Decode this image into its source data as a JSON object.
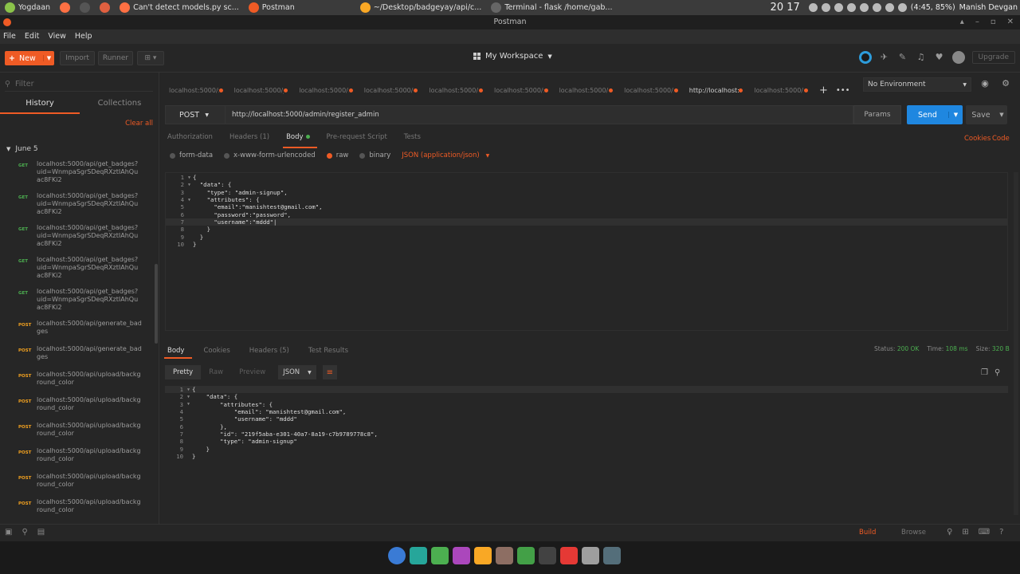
{
  "topbar": {
    "items": [
      {
        "label": "Yogdaan",
        "color": "#8bc34a"
      },
      {
        "label": "",
        "color": "#ff7043"
      },
      {
        "label": "",
        "color": "#555555"
      },
      {
        "label": "",
        "color": "#e06040"
      },
      {
        "label": "Can't detect models.py sc...",
        "color": "#ff7043"
      },
      {
        "label": "Postman",
        "color": "#ef5b25"
      },
      {
        "label": "~/Desktop/badgeyay/api/c...",
        "color": "#f9a825"
      },
      {
        "label": "Terminal - flask  /home/gab...",
        "color": "#666666"
      }
    ],
    "clock": "20 17",
    "battery": "(4:45, 85%)",
    "user": "Manish Devgan"
  },
  "window": {
    "title": "Postman"
  },
  "menu": [
    "File",
    "Edit",
    "View",
    "Help"
  ],
  "toolbar": {
    "new_label": "New",
    "import_label": "Import",
    "runner_label": "Runner",
    "workspace_label": "My Workspace",
    "upgrade_label": "Upgrade"
  },
  "sidebar": {
    "filter_placeholder": "Filter",
    "tabs": [
      "History",
      "Collections"
    ],
    "clear_all": "Clear all",
    "date_group": "June 5",
    "history": [
      {
        "method": "GET",
        "url": "localhost:5000/api/get_badges?uid=WnmpaSgrSDeqRXztIAhQuac8FKi2"
      },
      {
        "method": "GET",
        "url": "localhost:5000/api/get_badges?uid=WnmpaSgrSDeqRXztIAhQuac8FKi2"
      },
      {
        "method": "GET",
        "url": "localhost:5000/api/get_badges?uid=WnmpaSgrSDeqRXztIAhQuac8FKi2"
      },
      {
        "method": "GET",
        "url": "localhost:5000/api/get_badges?uid=WnmpaSgrSDeqRXztIAhQuac8FKi2"
      },
      {
        "method": "GET",
        "url": "localhost:5000/api/get_badges?uid=WnmpaSgrSDeqRXztIAhQuac8FKi2"
      },
      {
        "method": "POST",
        "url": "localhost:5000/api/generate_badges"
      },
      {
        "method": "POST",
        "url": "localhost:5000/api/generate_badges"
      },
      {
        "method": "POST",
        "url": "localhost:5000/api/upload/background_color"
      },
      {
        "method": "POST",
        "url": "localhost:5000/api/upload/background_color"
      },
      {
        "method": "POST",
        "url": "localhost:5000/api/upload/background_color"
      },
      {
        "method": "POST",
        "url": "localhost:5000/api/upload/background_color"
      },
      {
        "method": "POST",
        "url": "localhost:5000/api/upload/background_color"
      },
      {
        "method": "POST",
        "url": "localhost:5000/api/upload/background_color"
      }
    ]
  },
  "request_tabs": [
    {
      "label": "localhost:5000/:",
      "active": false
    },
    {
      "label": "localhost:5000/j",
      "active": false
    },
    {
      "label": "localhost:5000/:",
      "active": false
    },
    {
      "label": "localhost:5000/:",
      "active": false
    },
    {
      "label": "localhost:5000/:",
      "active": false
    },
    {
      "label": "localhost:5000/:",
      "active": false
    },
    {
      "label": "localhost:5000/:",
      "active": false
    },
    {
      "label": "localhost:5000/:",
      "active": false
    },
    {
      "label": "http://localhost:",
      "active": true
    },
    {
      "label": "localhost:5000/:",
      "active": false
    }
  ],
  "environment": {
    "selected": "No Environment"
  },
  "request": {
    "method": "POST",
    "url": "http://localhost:5000/admin/register_admin",
    "params_label": "Params",
    "send_label": "Send",
    "save_label": "Save",
    "tabs": [
      {
        "label": "Authorization",
        "active": false
      },
      {
        "label": "Headers (1)",
        "active": false
      },
      {
        "label": "Body",
        "active": true
      },
      {
        "label": "Pre-request Script",
        "active": false
      },
      {
        "label": "Tests",
        "active": false
      }
    ],
    "cookies_label": "Cookies",
    "code_label": "Code",
    "body_types": [
      {
        "label": "form-data",
        "selected": false
      },
      {
        "label": "x-www-form-urlencoded",
        "selected": false
      },
      {
        "label": "raw",
        "selected": true
      },
      {
        "label": "binary",
        "selected": false
      }
    ],
    "content_type": "JSON (application/json)",
    "body_lines": [
      {
        "n": "1",
        "fold": true,
        "text": "{"
      },
      {
        "n": "2",
        "fold": true,
        "text": "  \"data\": {"
      },
      {
        "n": "3",
        "fold": false,
        "text": "    \"type\": \"admin-signup\","
      },
      {
        "n": "4",
        "fold": true,
        "text": "    \"attributes\": {"
      },
      {
        "n": "5",
        "fold": false,
        "text": "      \"email\":\"manishtest@gmail.com\","
      },
      {
        "n": "6",
        "fold": false,
        "text": "      \"password\":\"password\","
      },
      {
        "n": "7",
        "fold": false,
        "text": "      \"username\":\"mddd\"|"
      },
      {
        "n": "8",
        "fold": false,
        "text": "    }"
      },
      {
        "n": "9",
        "fold": false,
        "text": "  }"
      },
      {
        "n": "10",
        "fold": false,
        "text": "}"
      }
    ]
  },
  "response": {
    "tabs": [
      {
        "label": "Body",
        "active": true
      },
      {
        "label": "Cookies",
        "active": false
      },
      {
        "label": "Headers (5)",
        "active": false
      },
      {
        "label": "Test Results",
        "active": false
      }
    ],
    "status_label": "Status:",
    "status_value": "200 OK",
    "time_label": "Time:",
    "time_value": "108 ms",
    "size_label": "Size:",
    "size_value": "320 B",
    "views": [
      "Pretty",
      "Raw",
      "Preview"
    ],
    "format": "JSON",
    "body_lines": [
      {
        "n": "1",
        "fold": true,
        "text": "{"
      },
      {
        "n": "2",
        "fold": true,
        "text": "    \"data\": {"
      },
      {
        "n": "3",
        "fold": true,
        "text": "        \"attributes\": {"
      },
      {
        "n": "4",
        "fold": false,
        "text": "            \"email\": \"manishtest@gmail.com\","
      },
      {
        "n": "5",
        "fold": false,
        "text": "            \"username\": \"mddd\""
      },
      {
        "n": "6",
        "fold": false,
        "text": "        },"
      },
      {
        "n": "7",
        "fold": false,
        "text": "        \"id\": \"219f5aba-e301-40a7-8a19-c7b9789778c8\","
      },
      {
        "n": "8",
        "fold": false,
        "text": "        \"type\": \"admin-signup\""
      },
      {
        "n": "9",
        "fold": false,
        "text": "    }"
      },
      {
        "n": "10",
        "fold": false,
        "text": "}"
      }
    ]
  },
  "statusbar": {
    "build_label": "Build",
    "browse_label": "Browse"
  },
  "dock_colors": [
    "#3a7bd5",
    "#26a69a",
    "#4caf50",
    "#ab47bc",
    "#f9a825",
    "#8d6e63",
    "#43a047",
    "#424242",
    "#e53935",
    "#9e9e9e",
    "#546e7a"
  ]
}
